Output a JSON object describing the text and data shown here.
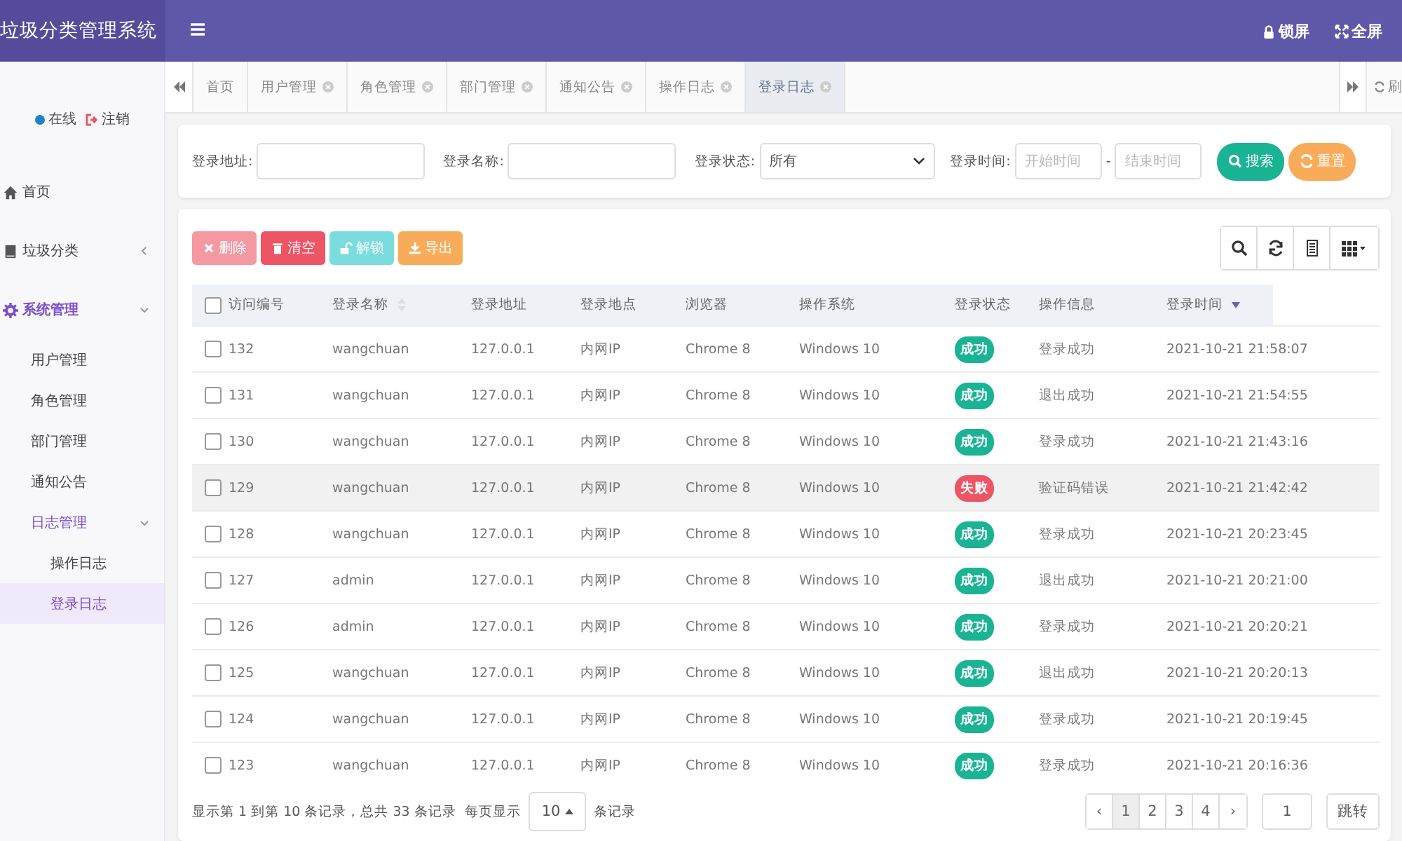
{
  "header": {
    "title": "垃圾分类管理系统",
    "actions": [
      {
        "kind": "lock",
        "label": "锁屏"
      },
      {
        "kind": "fullscreen",
        "label": "全屏"
      }
    ]
  },
  "user_panel": {
    "status": "在线",
    "logout": "注销"
  },
  "sidebar": {
    "items": [
      {
        "kind": "home",
        "label": "首页",
        "expanded": false,
        "selected": false
      },
      {
        "kind": "book",
        "label": "垃圾分类",
        "expanded": false,
        "selected": false
      },
      {
        "kind": "gear",
        "label": "系统管理",
        "expanded": true,
        "selected": false,
        "children": [
          {
            "label": "用户管理",
            "selected": false
          },
          {
            "label": "角色管理",
            "selected": false
          },
          {
            "label": "部门管理",
            "selected": false
          },
          {
            "label": "通知公告",
            "selected": false
          },
          {
            "label": "日志管理",
            "expanded": true,
            "selected": false,
            "children": [
              {
                "label": "操作日志",
                "selected": false
              },
              {
                "label": "登录日志",
                "selected": true
              }
            ]
          }
        ]
      }
    ]
  },
  "tabs": [
    {
      "label": "首页",
      "closable": false,
      "selected": false
    },
    {
      "label": "用户管理",
      "closable": true,
      "selected": false
    },
    {
      "label": "角色管理",
      "closable": true,
      "selected": false
    },
    {
      "label": "部门管理",
      "closable": true,
      "selected": false
    },
    {
      "label": "通知公告",
      "closable": true,
      "selected": false
    },
    {
      "label": "操作日志",
      "closable": true,
      "selected": false
    },
    {
      "label": "登录日志",
      "closable": true,
      "selected": true
    }
  ],
  "refresh": "刷",
  "search": {
    "address_label": "登录地址:",
    "name_label": "登录名称:",
    "status_label": "登录状态:",
    "status_value": "所有",
    "time_label": "登录时间:",
    "start_placeholder": "开始时间",
    "separator": "-",
    "end_placeholder": "结束时间",
    "search_button": "搜索",
    "reset_button": "重置"
  },
  "toolbar": [
    {
      "kind": "delete",
      "label": "删除",
      "disabled": true
    },
    {
      "kind": "clear",
      "label": "清空",
      "disabled": false
    },
    {
      "kind": "unlock",
      "label": "解锁",
      "disabled": true
    },
    {
      "kind": "export",
      "label": "导出",
      "disabled": false
    }
  ],
  "table": {
    "select_all_checked": false,
    "columns": [
      {
        "label": "访问编号",
        "sortable": false,
        "sorted_desc": false
      },
      {
        "label": "登录名称",
        "sortable": true,
        "sorted_desc": false
      },
      {
        "label": "登录地址",
        "sortable": false,
        "sorted_desc": false
      },
      {
        "label": "登录地点",
        "sortable": false,
        "sorted_desc": false
      },
      {
        "label": "浏览器",
        "sortable": false,
        "sorted_desc": false
      },
      {
        "label": "操作系统",
        "sortable": false,
        "sorted_desc": false
      },
      {
        "label": "登录状态",
        "sortable": false,
        "sorted_desc": false
      },
      {
        "label": "操作信息",
        "sortable": false,
        "sorted_desc": false
      },
      {
        "label": "登录时间",
        "sortable": true,
        "sorted_desc": true
      }
    ],
    "rows": [
      {
        "id": "132",
        "name": "wangchuan",
        "ip": "127.0.0.1",
        "location": "内网IP",
        "browser": "Chrome 8",
        "os": "Windows 10",
        "status": {
          "kind": "success",
          "label": "成功"
        },
        "message": "登录成功",
        "time": "2021-10-21 21:58:07",
        "checked": false,
        "hovered": false
      },
      {
        "id": "131",
        "name": "wangchuan",
        "ip": "127.0.0.1",
        "location": "内网IP",
        "browser": "Chrome 8",
        "os": "Windows 10",
        "status": {
          "kind": "success",
          "label": "成功"
        },
        "message": "退出成功",
        "time": "2021-10-21 21:54:55",
        "checked": false,
        "hovered": false
      },
      {
        "id": "130",
        "name": "wangchuan",
        "ip": "127.0.0.1",
        "location": "内网IP",
        "browser": "Chrome 8",
        "os": "Windows 10",
        "status": {
          "kind": "success",
          "label": "成功"
        },
        "message": "登录成功",
        "time": "2021-10-21 21:43:16",
        "checked": false,
        "hovered": false
      },
      {
        "id": "129",
        "name": "wangchuan",
        "ip": "127.0.0.1",
        "location": "内网IP",
        "browser": "Chrome 8",
        "os": "Windows 10",
        "status": {
          "kind": "fail",
          "label": "失败"
        },
        "message": "验证码错误",
        "time": "2021-10-21 21:42:42",
        "checked": false,
        "hovered": true
      },
      {
        "id": "128",
        "name": "wangchuan",
        "ip": "127.0.0.1",
        "location": "内网IP",
        "browser": "Chrome 8",
        "os": "Windows 10",
        "status": {
          "kind": "success",
          "label": "成功"
        },
        "message": "登录成功",
        "time": "2021-10-21 20:23:45",
        "checked": false,
        "hovered": false
      },
      {
        "id": "127",
        "name": "admin",
        "ip": "127.0.0.1",
        "location": "内网IP",
        "browser": "Chrome 8",
        "os": "Windows 10",
        "status": {
          "kind": "success",
          "label": "成功"
        },
        "message": "退出成功",
        "time": "2021-10-21 20:21:00",
        "checked": false,
        "hovered": false
      },
      {
        "id": "126",
        "name": "admin",
        "ip": "127.0.0.1",
        "location": "内网IP",
        "browser": "Chrome 8",
        "os": "Windows 10",
        "status": {
          "kind": "success",
          "label": "成功"
        },
        "message": "登录成功",
        "time": "2021-10-21 20:20:21",
        "checked": false,
        "hovered": false
      },
      {
        "id": "125",
        "name": "wangchuan",
        "ip": "127.0.0.1",
        "location": "内网IP",
        "browser": "Chrome 8",
        "os": "Windows 10",
        "status": {
          "kind": "success",
          "label": "成功"
        },
        "message": "退出成功",
        "time": "2021-10-21 20:20:13",
        "checked": false,
        "hovered": false
      },
      {
        "id": "124",
        "name": "wangchuan",
        "ip": "127.0.0.1",
        "location": "内网IP",
        "browser": "Chrome 8",
        "os": "Windows 10",
        "status": {
          "kind": "success",
          "label": "成功"
        },
        "message": "登录成功",
        "time": "2021-10-21 20:19:45",
        "checked": false,
        "hovered": false
      },
      {
        "id": "123",
        "name": "wangchuan",
        "ip": "127.0.0.1",
        "location": "内网IP",
        "browser": "Chrome 8",
        "os": "Windows 10",
        "status": {
          "kind": "success",
          "label": "成功"
        },
        "message": "登录成功",
        "time": "2021-10-21 20:16:36",
        "checked": false,
        "hovered": false
      }
    ]
  },
  "pagination": {
    "summary": "显示第 1 到第 10 条记录，总共 33 条记录",
    "per_page_label": "每页显示",
    "page_size": "10",
    "per_page_suffix": "条记录",
    "prev": "‹",
    "pages": [
      {
        "label": "1",
        "selected": true
      },
      {
        "label": "2",
        "selected": false
      },
      {
        "label": "3",
        "selected": false
      },
      {
        "label": "4",
        "selected": false
      }
    ],
    "next": "›",
    "jump_value": "1",
    "jump_button": "跳转"
  }
}
